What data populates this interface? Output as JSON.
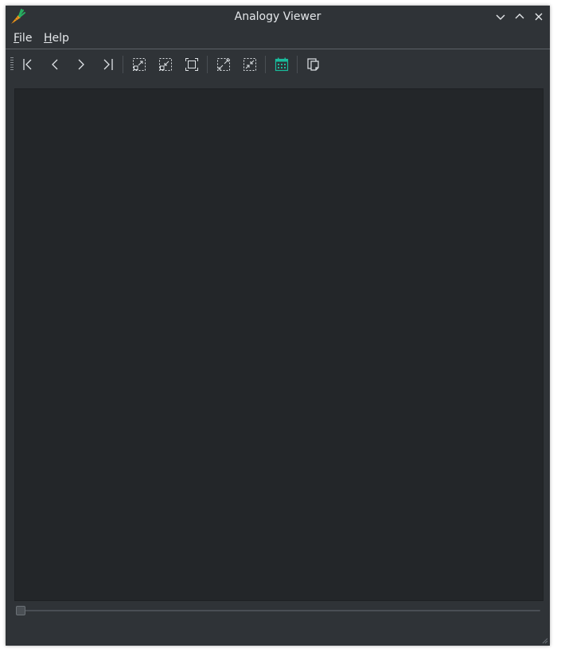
{
  "window": {
    "title": "Analogy Viewer",
    "app_icon": "carrot-icon",
    "controls": [
      "minimize-icon",
      "maximize-icon",
      "close-icon"
    ]
  },
  "menubar": {
    "items": [
      {
        "label": "File",
        "mnemonic": "F",
        "rest": "ile"
      },
      {
        "label": "Help",
        "mnemonic": "H",
        "rest": "elp"
      }
    ]
  },
  "toolbar": {
    "buttons": [
      {
        "icon": "first-page-icon"
      },
      {
        "icon": "previous-icon"
      },
      {
        "icon": "next-icon"
      },
      {
        "icon": "last-page-icon"
      },
      {
        "icon": "zoom-in-selection-icon"
      },
      {
        "icon": "zoom-out-selection-icon"
      },
      {
        "icon": "fit-to-window-icon"
      },
      {
        "icon": "expand-selection-icon"
      },
      {
        "icon": "shrink-selection-icon"
      },
      {
        "icon": "grid-view-icon"
      },
      {
        "icon": "copy-icon"
      }
    ]
  },
  "colors": {
    "window_bg": "#2f3337",
    "viewport_bg": "#232629",
    "text": "#e4e7ea",
    "accent_green": "#1abc9c",
    "carrot_orange": "#f39c1f",
    "carrot_green": "#27ae60"
  },
  "slider": {
    "value_fraction": 0
  }
}
